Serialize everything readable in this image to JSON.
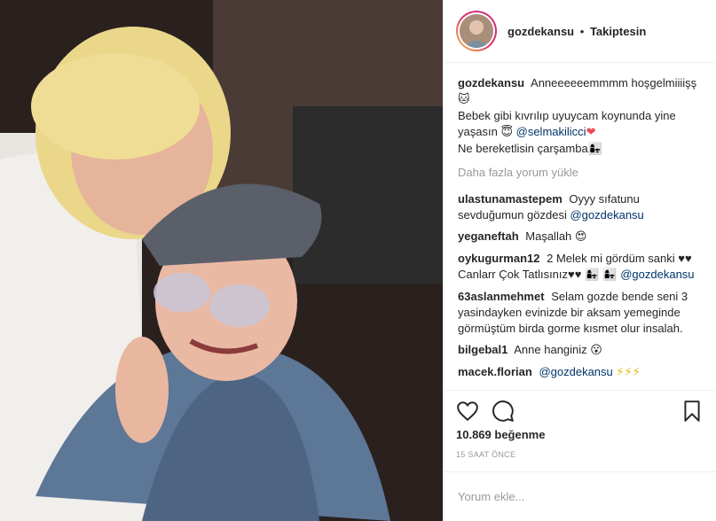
{
  "header": {
    "username": "gozdekansu",
    "separator": "•",
    "follow_label": "Takiptesin"
  },
  "caption": {
    "username": "gozdekansu",
    "line1": "Anneeeeeemmmm hoşgelmiiiişş",
    "emoji1": "🐱",
    "line2": "Bebek gibi kıvrılıp uyuycam koynunda yine yaşasın",
    "emoji2": "😇",
    "mention": "@selmakilicci",
    "emoji3": "❤",
    "line3": "Ne bereketlisin çarşamba",
    "emoji4": "👩‍👧"
  },
  "load_more": "Daha fazla yorum yükle",
  "comments": [
    {
      "user": "ulastunamastepem",
      "text": "Oyyy sıfatunu sevduğumun gözdesi",
      "mention": "@gozdekansu",
      "emoji": ""
    },
    {
      "user": "yeganeftah",
      "text": "Maşallah",
      "mention": "",
      "emoji": "😍"
    },
    {
      "user": "oykugurman12",
      "text": "2 Melek mi gördüm sanki ♥♥ Canlarr Çok Tatlısınız♥♥",
      "mention": "@gozdekansu",
      "emoji": "👩‍👧 👩‍👧"
    },
    {
      "user": "63aslanmehmet",
      "text": "Selam gozde bende seni 3 yasindayken evinizde bir aksam yemeginde görmüştüm birda gorme kısmet olur insalah.",
      "mention": "",
      "emoji": ""
    },
    {
      "user": "bilgebal1",
      "text": "Anne hanginiz",
      "mention": "",
      "emoji": "😮"
    },
    {
      "user": "macek.florian",
      "text": "",
      "mention": "@gozdekansu",
      "emoji": "⚡⚡⚡"
    }
  ],
  "likes": "10.869 beğenme",
  "timestamp": "15 SAAT ÖNCE",
  "add_comment_placeholder": "Yorum ekle...",
  "icons": {
    "like": "heart-icon",
    "comment": "comment-bubble-icon",
    "save": "bookmark-icon"
  }
}
